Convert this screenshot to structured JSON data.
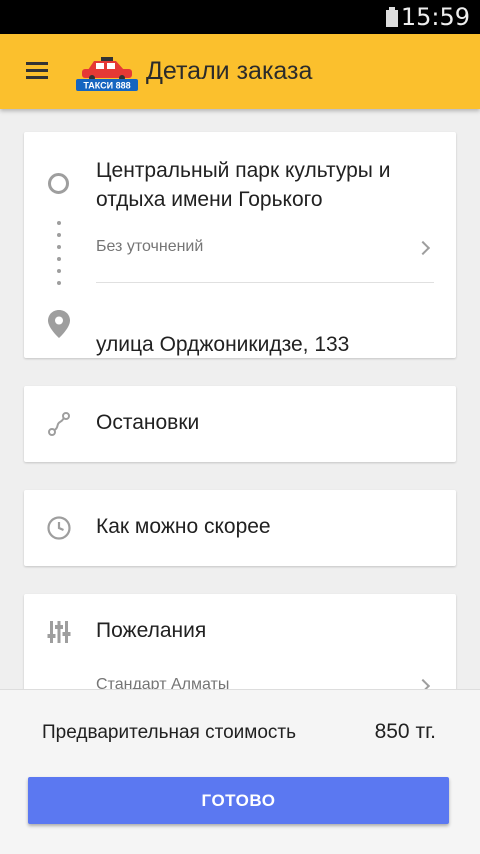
{
  "status_bar": {
    "time": "15:59",
    "icons": [
      "battery-icon"
    ]
  },
  "app_bar": {
    "title": "Детали заказа",
    "menu_icon": "hamburger-menu-icon",
    "logo_text": "ТАКСИ 888"
  },
  "route": {
    "from": "Центральный парк культуры и отдыха имени Горького",
    "from_note": "Без уточнений",
    "to": "улица Орджоникидзе, 133"
  },
  "stops": {
    "label": "Остановки",
    "icon": "route-icon"
  },
  "time": {
    "label": "Как можно скорее",
    "icon": "clock-icon"
  },
  "wishes": {
    "label": "Пожелания",
    "sub": "Стандарт Алматы",
    "icon": "sliders-icon"
  },
  "footer": {
    "price_label": "Предварительная стоимость",
    "price_value": "850 тг.",
    "done_label": "ГОТОВО"
  },
  "colors": {
    "app_bar": "#fbc02d",
    "button": "#5b78f1"
  }
}
